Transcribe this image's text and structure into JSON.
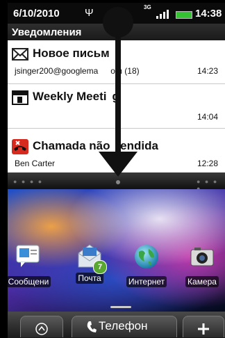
{
  "status_bar": {
    "date": "6/10/2010",
    "network": "3G",
    "time": "14:38"
  },
  "notifications_header": "Уведомления",
  "notifications": [
    {
      "icon": "mail-icon",
      "title": "Новое письм",
      "subtitle": "jsinger200@googlema",
      "subtitle_suffix": "om (18)",
      "time": "14:23"
    },
    {
      "icon": "calendar-icon",
      "title": "Weekly Meeti",
      "title_suffix": "g",
      "time": "14:04"
    },
    {
      "icon": "missed-call-icon",
      "title": "Chamada não",
      "title_suffix": "tendida",
      "subtitle": "Ben Carter",
      "time": "12:28"
    }
  ],
  "home_apps": [
    {
      "icon": "messages-icon",
      "label": "Сообщени"
    },
    {
      "icon": "mail-icon",
      "label": "Почта",
      "badge": "7"
    },
    {
      "icon": "internet-globe-icon",
      "label": "Интернет"
    },
    {
      "icon": "camera-icon",
      "label": "Камера"
    }
  ],
  "dock": {
    "phone_label": "Телефон"
  },
  "colors": {
    "battery": "#35c233",
    "badge": "#5aa832"
  }
}
